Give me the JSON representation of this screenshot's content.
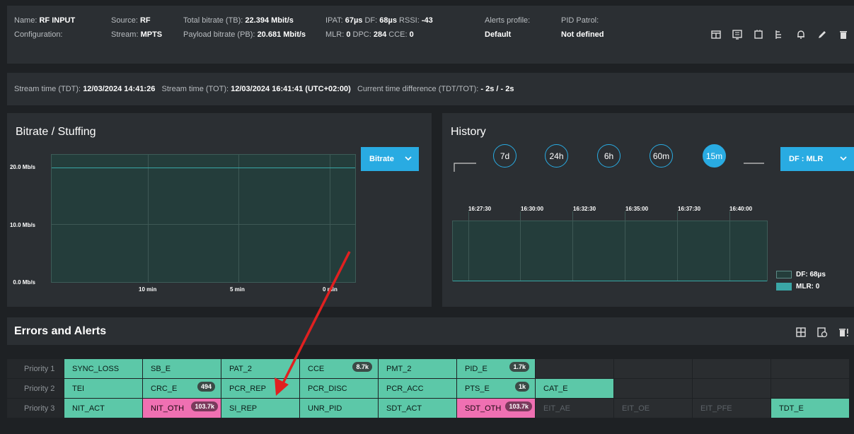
{
  "stream": {
    "name_label": "Name:",
    "name_value": "RF INPUT",
    "source_label": "Source:",
    "source_value": "RF",
    "config_label": "Configuration:",
    "stream_label": "Stream:",
    "stream_value": "MPTS",
    "total_bitrate_label": "Total bitrate (TB):",
    "total_bitrate_value": "22.394 Mbit/s",
    "payload_bitrate_label": "Payload bitrate (PB):",
    "payload_bitrate_value": "20.681 Mbit/s",
    "ipat_label": "IPAT:",
    "ipat_value": "67µs",
    "df_label": "DF:",
    "df_value": "68µs",
    "rssi_label": "RSSI:",
    "rssi_value": "-43",
    "mlr_label": "MLR:",
    "mlr_value": "0",
    "dpc_label": "DPC:",
    "dpc_value": "284",
    "cce_label": "CCE:",
    "cce_value": "0",
    "alerts_profile_label": "Alerts profile:",
    "alerts_profile_value": "Default",
    "pid_patrol_label": "PID Patrol:",
    "pid_patrol_value": "Not defined"
  },
  "time": {
    "tdt_label": "Stream time (TDT):",
    "tdt_value": "12/03/2024 14:41:26",
    "tot_label": "Stream time (TOT):",
    "tot_value": "12/03/2024 16:41:41 (UTC+02:00)",
    "diff_label": "Current time difference (TDT/TOT):",
    "diff_value": "- 2s / - 2s"
  },
  "bitrate_panel": {
    "title": "Bitrate / Stuffing",
    "dropdown": "Bitrate",
    "y_ticks": [
      "20.0 Mb/s",
      "10.0 Mb/s",
      "0.0 Mb/s"
    ],
    "x_ticks": [
      "10 min",
      "5 min",
      "0 min"
    ]
  },
  "history_panel": {
    "title": "History",
    "ranges": [
      "7d",
      "24h",
      "6h",
      "60m",
      "15m"
    ],
    "active_range": "15m",
    "dropdown": "DF : MLR",
    "x_ticks": [
      "16:27:30",
      "16:30:00",
      "16:32:30",
      "16:35:00",
      "16:37:30",
      "16:40:00"
    ],
    "legend": [
      {
        "label": "DF: 68µs",
        "color": "#243d3b"
      },
      {
        "label": "MLR: 0",
        "color": "#3aa6a6"
      }
    ]
  },
  "alerts": {
    "title": "Errors and Alerts",
    "rows": [
      {
        "label": "Priority 1",
        "cells": [
          {
            "name": "SYNC_LOSS",
            "state": "ok"
          },
          {
            "name": "SB_E",
            "state": "ok"
          },
          {
            "name": "PAT_2",
            "state": "ok"
          },
          {
            "name": "CCE",
            "state": "ok",
            "badge": "8.7k"
          },
          {
            "name": "PMT_2",
            "state": "ok"
          },
          {
            "name": "PID_E",
            "state": "ok",
            "badge": "1.7k"
          },
          {
            "name": "",
            "state": "dark"
          },
          {
            "name": "",
            "state": "dark"
          },
          {
            "name": "",
            "state": "dark"
          },
          {
            "name": "",
            "state": "dark"
          }
        ]
      },
      {
        "label": "Priority 2",
        "cells": [
          {
            "name": "TEI",
            "state": "ok"
          },
          {
            "name": "CRC_E",
            "state": "ok",
            "badge": "494"
          },
          {
            "name": "PCR_REP",
            "state": "ok"
          },
          {
            "name": "PCR_DISC",
            "state": "ok"
          },
          {
            "name": "PCR_ACC",
            "state": "ok"
          },
          {
            "name": "PTS_E",
            "state": "ok",
            "badge": "1k"
          },
          {
            "name": "CAT_E",
            "state": "ok"
          },
          {
            "name": "",
            "state": "dark"
          },
          {
            "name": "",
            "state": "dark"
          },
          {
            "name": "",
            "state": "dark"
          }
        ]
      },
      {
        "label": "Priority 3",
        "cells": [
          {
            "name": "NIT_ACT",
            "state": "ok"
          },
          {
            "name": "NIT_OTH",
            "state": "err",
            "badge": "103.7k"
          },
          {
            "name": "SI_REP",
            "state": "ok"
          },
          {
            "name": "UNR_PID",
            "state": "ok"
          },
          {
            "name": "SDT_ACT",
            "state": "ok"
          },
          {
            "name": "SDT_OTH",
            "state": "err",
            "badge": "103.7k"
          },
          {
            "name": "EIT_AE",
            "state": "dark"
          },
          {
            "name": "EIT_OE",
            "state": "dark"
          },
          {
            "name": "EIT_PFE",
            "state": "dark"
          },
          {
            "name": "TDT_E",
            "state": "ok"
          }
        ]
      }
    ]
  },
  "colors": {
    "accent": "#29abe2",
    "ok": "#5cc8a8",
    "error": "#ef70b2",
    "arrow": "#e02020"
  }
}
